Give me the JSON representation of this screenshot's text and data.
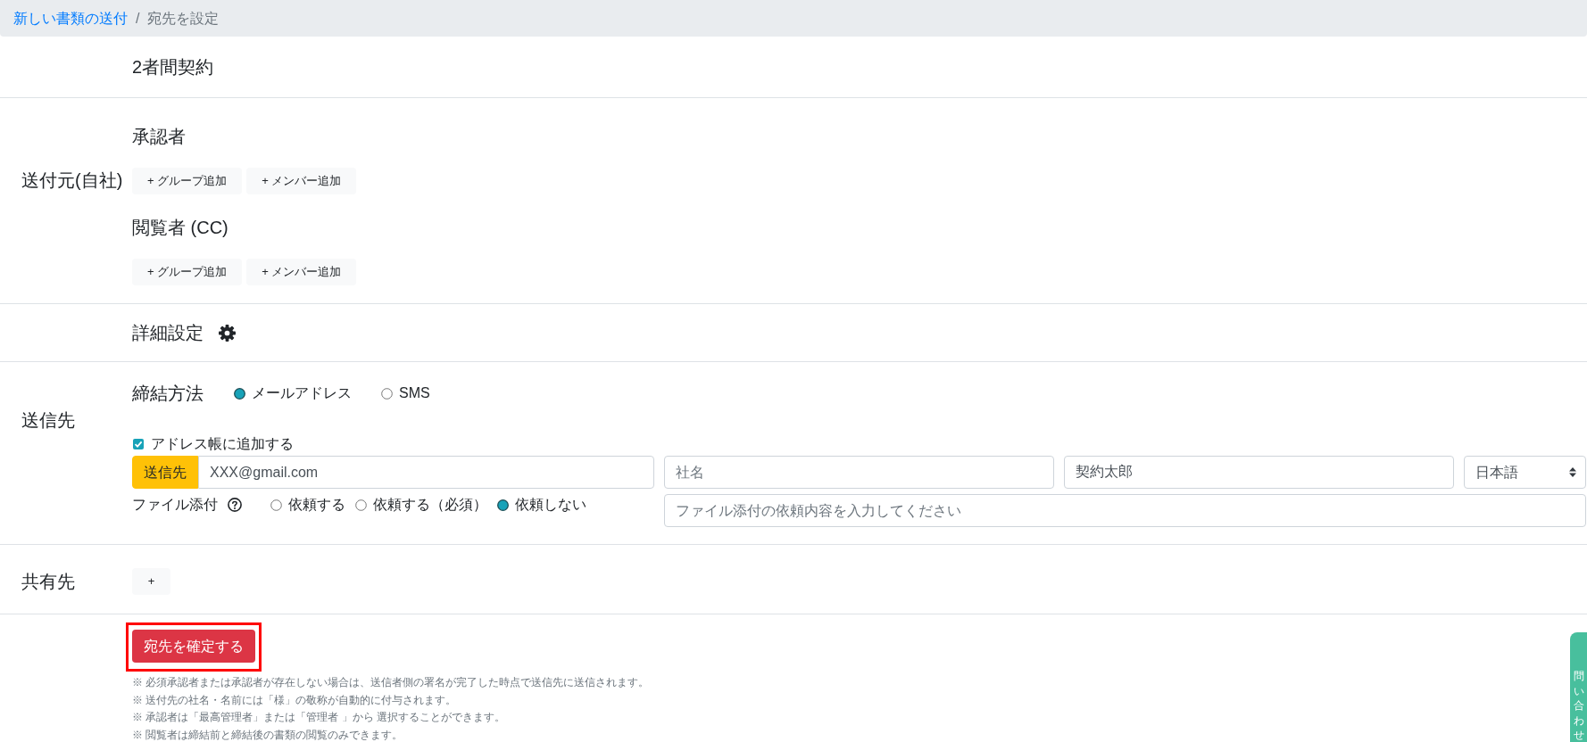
{
  "breadcrumb": {
    "separator": "/",
    "items": [
      {
        "label": "新しい書類の送付",
        "kind": "link"
      },
      {
        "label": "宛先を設定",
        "kind": "current"
      }
    ]
  },
  "contract_type": "2者間契約",
  "sender": {
    "label": "送付元(自社)",
    "groups": [
      {
        "title": "承認者",
        "buttons": [
          "+ グループ追加",
          "+ メンバー追加"
        ]
      },
      {
        "title": "閲覧者 (CC)",
        "buttons": [
          "+ グループ追加",
          "+ メンバー追加"
        ]
      }
    ]
  },
  "advanced_settings": {
    "label": "詳細設定"
  },
  "recipient": {
    "label": "送信先",
    "method": {
      "label": "締結方法",
      "options": [
        {
          "label": "メールアドレス",
          "selected": true
        },
        {
          "label": "SMS",
          "selected": false
        }
      ]
    },
    "add_to_address_book": {
      "label": "アドレス帳に追加する",
      "checked": true
    },
    "email": {
      "prefix": "送信先",
      "value": "XXX@gmail.com"
    },
    "company": {
      "placeholder": "社名"
    },
    "name": {
      "value": "契約太郎"
    },
    "language": {
      "value": "日本語"
    },
    "file_attachment": {
      "label": "ファイル添付",
      "options": [
        {
          "label": "依頼する",
          "selected": false
        },
        {
          "label": "依頼する（必須）",
          "selected": false
        },
        {
          "label": "依頼しない",
          "selected": true
        }
      ],
      "placeholder": "ファイル添付の依頼内容を入力してください"
    }
  },
  "share": {
    "label": "共有先",
    "button": "+"
  },
  "confirm_button": {
    "label": "宛先を確定する",
    "highlighted": true
  },
  "notes": [
    "※ 必須承認者または承認者が存在しない場合は、送信者側の署名が完了した時点で送信先に送信されます。",
    "※ 送付先の社名・名前には「様」の敬称が自動的に付与されます。",
    "※ 承認者は「最高管理者」または「管理者 」から 選択することができます。",
    "※ 閲覧者は締結前と締結後の書類の閲覧のみできます。"
  ],
  "side_tab": {
    "label": "問い合わせ"
  }
}
